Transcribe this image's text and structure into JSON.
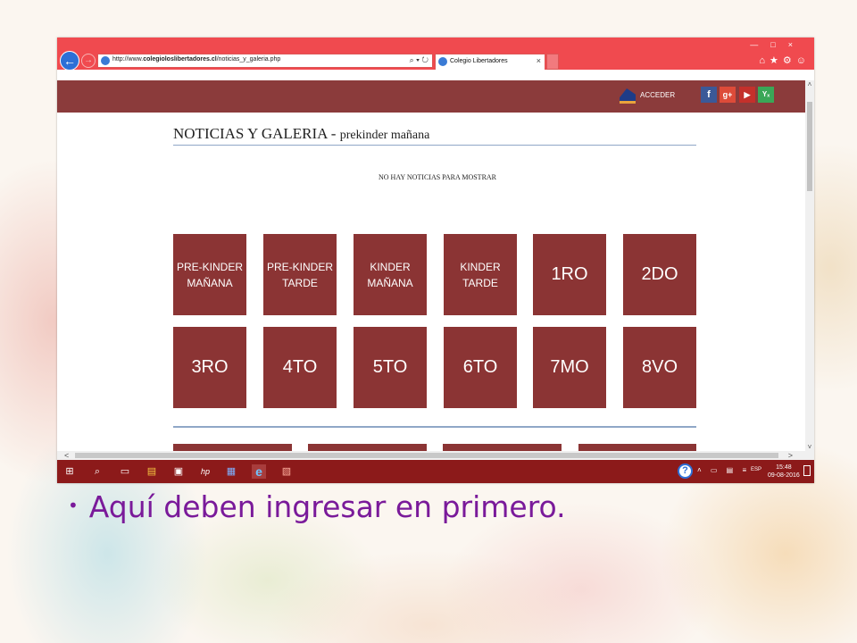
{
  "browser": {
    "url_prefix": "http://www.",
    "url_domain": "colegioloslibertadores.cl",
    "url_path": "/noticias_y_galeria.php",
    "address_controls": "⌕ ▾ ↻",
    "tab_title": "Colegio Libertadores",
    "tab_close": "×",
    "window_controls": "—□×",
    "toolbar_icons": "⌂★⚙☺",
    "back_glyph": "←",
    "forward_glyph": "→"
  },
  "site": {
    "acceder": "ACCEDER",
    "social": {
      "facebook": "f",
      "google_plus": "g+",
      "youtube": "▶",
      "other": "Yₓ"
    }
  },
  "page": {
    "title_main": "NOTICIAS Y GALERIA",
    "title_sep": " - ",
    "title_sub": "prekinder mañana",
    "no_news": "NO HAY NOTICIAS PARA MOSTRAR"
  },
  "tiles": [
    {
      "line1": "PRE-KINDER",
      "line2": "MAÑANA"
    },
    {
      "line1": "PRE-KINDER",
      "line2": "TARDE"
    },
    {
      "line1": "KINDER",
      "line2": "MAÑANA"
    },
    {
      "line1": "KINDER",
      "line2": "TARDE"
    },
    {
      "line1": "1RO"
    },
    {
      "line1": "2DO"
    },
    {
      "line1": "3RO"
    },
    {
      "line1": "4TO"
    },
    {
      "line1": "5TO"
    },
    {
      "line1": "6TO"
    },
    {
      "line1": "7MO"
    },
    {
      "line1": "8VO"
    }
  ],
  "scroll": {
    "up": "˄",
    "down": "˅",
    "left": "<",
    "right": ">"
  },
  "taskbar": {
    "start": "⊞",
    "search": "⌕",
    "taskview": "▭",
    "explorer": "▤",
    "store": "▣",
    "hp": "hp",
    "app1": "▦",
    "ie": "e",
    "app2": "▧",
    "help": "?",
    "tray": "˄ ▭ ▤ ≡",
    "lang": "ESP",
    "time": "15:48",
    "date": "09-08-2016"
  },
  "slide": {
    "bullet": "•",
    "text": "Aquí deben ingresar en primero."
  },
  "colors": {
    "tile": "#8b3434",
    "header": "#8b3b3b",
    "ie_chrome": "#f04a4f",
    "taskbar": "#8c1a1a",
    "bullet_text": "#7a1a9a"
  }
}
